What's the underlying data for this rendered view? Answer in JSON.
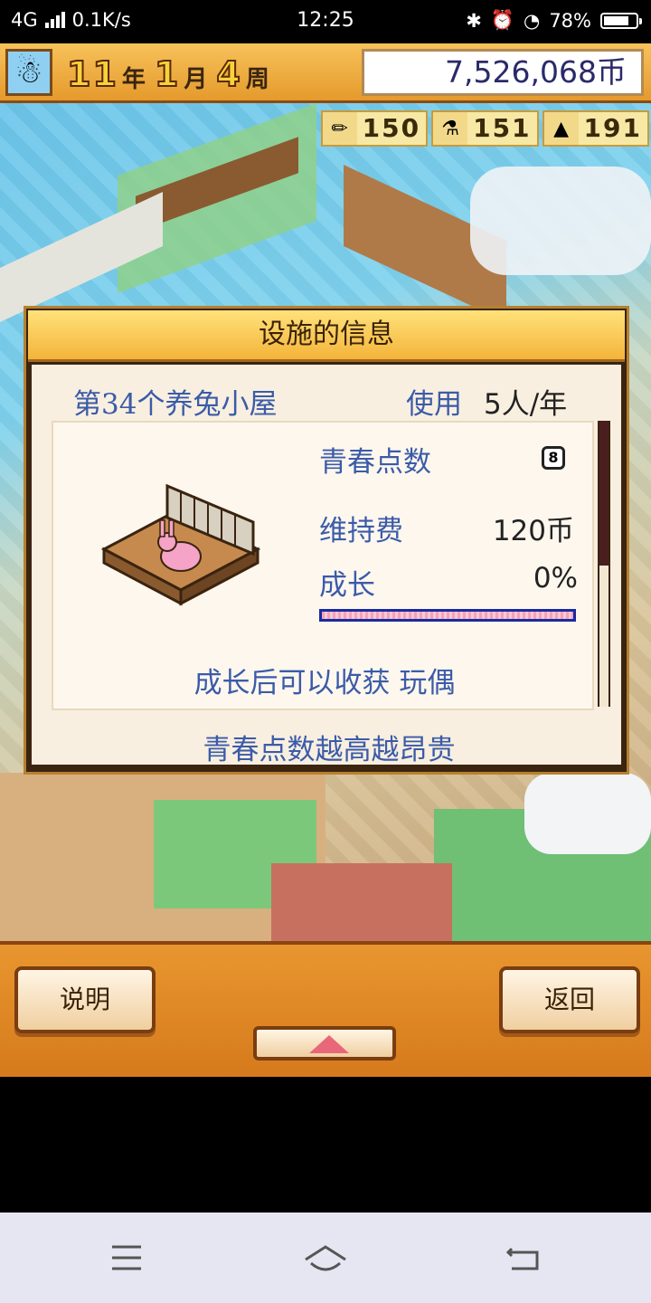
{
  "status_bar": {
    "network": "4G",
    "speed": "0.1K/s",
    "time": "12:25",
    "battery": "78%",
    "battery_level": 0.78
  },
  "hud": {
    "year_num": "11",
    "year_unit": "年",
    "month_num": "1",
    "month_unit": "月",
    "week_num": "4",
    "week_unit": "周",
    "money": "7,526,068币"
  },
  "resources": [
    {
      "icon": "pencil-icon",
      "value": "150"
    },
    {
      "icon": "flask-icon",
      "value": "151"
    },
    {
      "icon": "bell-icon",
      "value": "191"
    }
  ],
  "dialog": {
    "title": "设施的信息",
    "facility_name": "第34个养兔小屋",
    "usage_label": "使用",
    "usage_value": "5人/年",
    "youth_points_label": "青春点数",
    "youth_points_value": "8",
    "maintenance_label": "维持费",
    "maintenance_value": "120币",
    "growth_label": "成长",
    "growth_value": "0%",
    "growth_fraction": 0.0,
    "harvest_text": "成长后可以收获 玩偶",
    "footnote": "青春点数越高越昂贵"
  },
  "buttons": {
    "explain": "说明",
    "back": "返回"
  }
}
